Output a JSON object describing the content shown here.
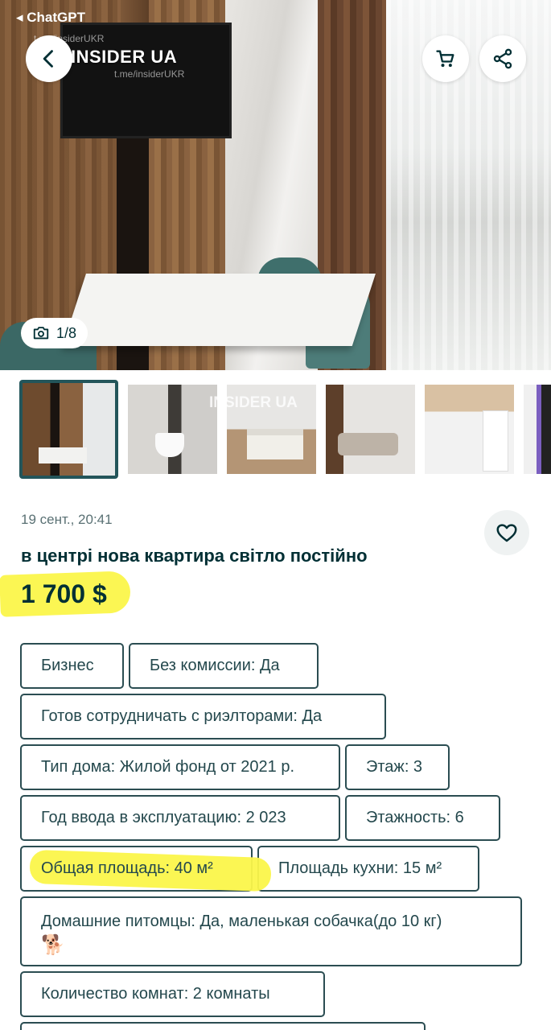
{
  "status_bar": {
    "back_app": "◂ ChatGPT"
  },
  "watermark": {
    "brand": "INSIDER UA",
    "handle": "t.me/insiderUKR",
    "small": "t.me/insiderUKR"
  },
  "gallery": {
    "counter": "1/8",
    "thumbnail_count": 6
  },
  "listing": {
    "date": "19 сент., 20:41",
    "title": "в центрі нова квартира світло постійно",
    "price": "1 700 $"
  },
  "tags": {
    "business": "Бизнес",
    "no_commission": "Без комиссии: Да",
    "realtors": "Готов сотрудничать с риэлторами: Да",
    "house_type": "Тип дома: Жилой фонд от 2021 р.",
    "floor": "Этаж: 3",
    "year_built": "Год ввода в эксплуатацию: 2 023",
    "floors_total": "Этажность: 6",
    "total_area": "Общая площадь: 40 м²",
    "kitchen_area": "Площадь кухни: 15 м²",
    "pets_line1": "Домашние питомцы: Да, маленькая собачка(до 10 кг)",
    "pets_emoji": "🐕",
    "rooms": "Количество комнат: 2 комнаты"
  },
  "colors": {
    "text": "#002f34",
    "tag_border": "#2b4d52",
    "highlight": "#fbf64a",
    "selected_thumb": "#23555a"
  }
}
